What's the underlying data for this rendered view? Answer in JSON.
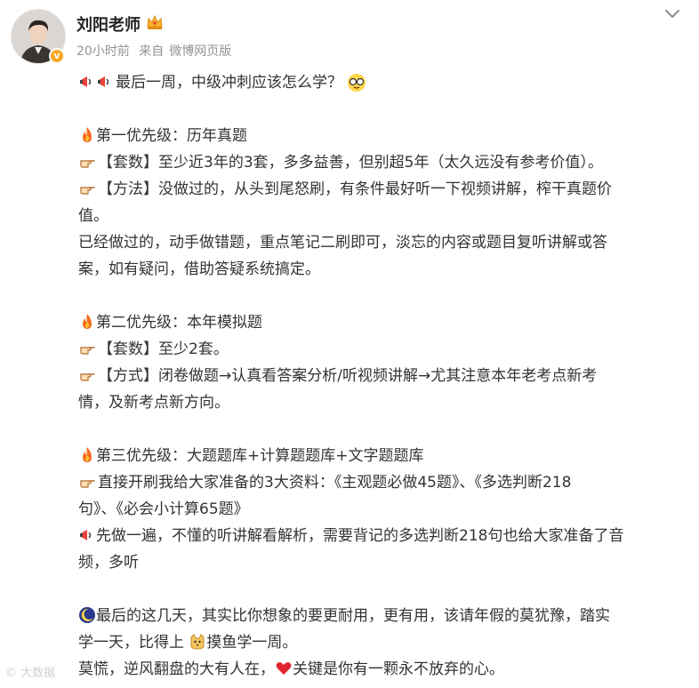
{
  "post": {
    "author": "刘阳老师",
    "time": "20小时前",
    "source_prefix": "来自",
    "source": "微博网页版",
    "badge": "v",
    "icons": {
      "crown": "crown-icon",
      "more": "chevron-down-icon",
      "megaphone": "megaphone-icon",
      "fire": "fire-icon",
      "point": "pointing-hand-icon",
      "moon": "moon-icon",
      "heart": "heart-icon",
      "cat": "cat-icon",
      "glasses": "glasses-emoji-icon"
    },
    "colors": {
      "name": "#222222",
      "meta": "#939393",
      "fire": "#f46a1c",
      "heart": "#e0242f",
      "badge": "#f5a623"
    },
    "lines": {
      "l1": "最后一周，中级冲刺应该怎么学？",
      "s1_title": "第一优先级：历年真题",
      "s1_a": "【套数】至少近3年的3套，多多益善，但别超5年（太久远没有参考价值）。",
      "s1_b1": "【方法】没做过的，从头到尾怒刷，有条件最好听一下视频讲解，榨干真题价",
      "s1_b2": "值。",
      "s1_c1": "已经做过的，动手做错题，重点笔记二刷即可，淡忘的内容或题目复听讲解或答",
      "s1_c2": "案，如有疑问，借助答疑系统搞定。",
      "s2_title": "第二优先级：本年模拟题",
      "s2_a": "【套数】至少2套。",
      "s2_b1": "【方式】闭卷做题→认真看答案分析/听视频讲解→尤其注意本年老考点新考",
      "s2_b2": "情，及新考点新方向。",
      "s3_title": "第三优先级：大题题库+计算题题库+文字题题库",
      "s3_a1": "直接开刷我给大家准备的3大资料：《主观题必做45题》、《多选判断218",
      "s3_a2": "句》、《必会小计算65题》",
      "s3_b1": "先做一遍，不懂的听讲解看解析，需要背记的多选判断218句也给大家准备了音",
      "s3_b2": "频，多听",
      "s4_a1": "最后的这几天，其实比你想象的要更耐用，更有用，该请年假的莫犹豫，踏实",
      "s4_a2a": "学一天，比得上",
      "s4_a2b": "摸鱼学一周。",
      "s4_b_a": "莫慌，逆风翻盘的大有人在，",
      "s4_b_b": "关键是你有一颗永不放弃的心。"
    },
    "watermark": "大数据"
  }
}
